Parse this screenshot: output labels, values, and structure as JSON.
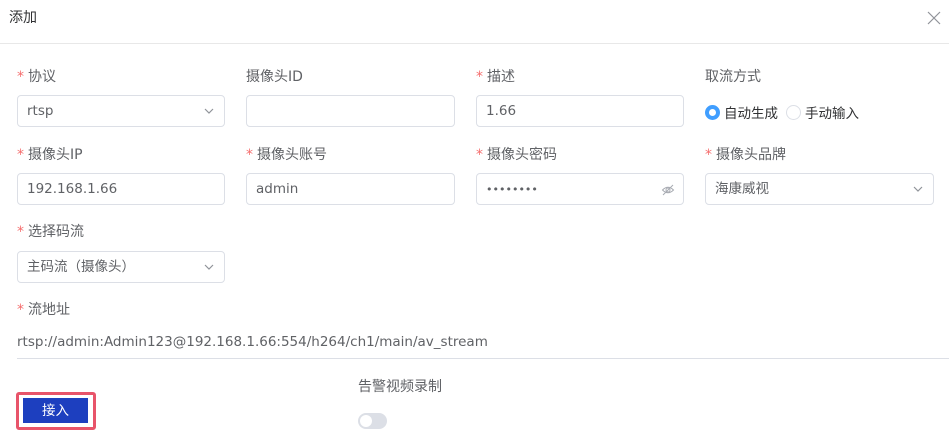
{
  "dialog": {
    "title": "添加"
  },
  "form": {
    "protocol": {
      "required": "*",
      "label": "协议",
      "value": "rtsp"
    },
    "camera_id": {
      "label": "摄像头ID",
      "value": ""
    },
    "description": {
      "required": "*",
      "label": "描述",
      "value": "1.66"
    },
    "stream_mode": {
      "label": "取流方式",
      "options": [
        {
          "label": "自动生成",
          "checked": true
        },
        {
          "label": "手动输入",
          "checked": false
        }
      ]
    },
    "camera_ip": {
      "required": "*",
      "label": "摄像头IP",
      "value": "192.168.1.66"
    },
    "camera_account": {
      "required": "*",
      "label": "摄像头账号",
      "value": "admin"
    },
    "camera_password": {
      "required": "*",
      "label": "摄像头密码",
      "value": "••••••••"
    },
    "camera_brand": {
      "required": "*",
      "label": "摄像头品牌",
      "value": "海康威视"
    },
    "stream_type": {
      "required": "*",
      "label": "选择码流",
      "value": "主码流（摄像头）"
    },
    "stream_url": {
      "required": "*",
      "label": "流地址",
      "value": "rtsp://admin:Admin123@192.168.1.66:554/h264/ch1/main/av_stream"
    },
    "alarm_recording": {
      "label": "告警视频录制",
      "enabled": false
    }
  },
  "actions": {
    "connect_label": "接入"
  },
  "colors": {
    "required": "#f56c6c",
    "primary": "#1d3fbf",
    "radio_checked": "#409eff",
    "highlight_border": "#e8546a"
  },
  "icons": {
    "close": "close-icon",
    "chevron": "chevron-down-icon",
    "eye_off": "eye-off-icon"
  }
}
